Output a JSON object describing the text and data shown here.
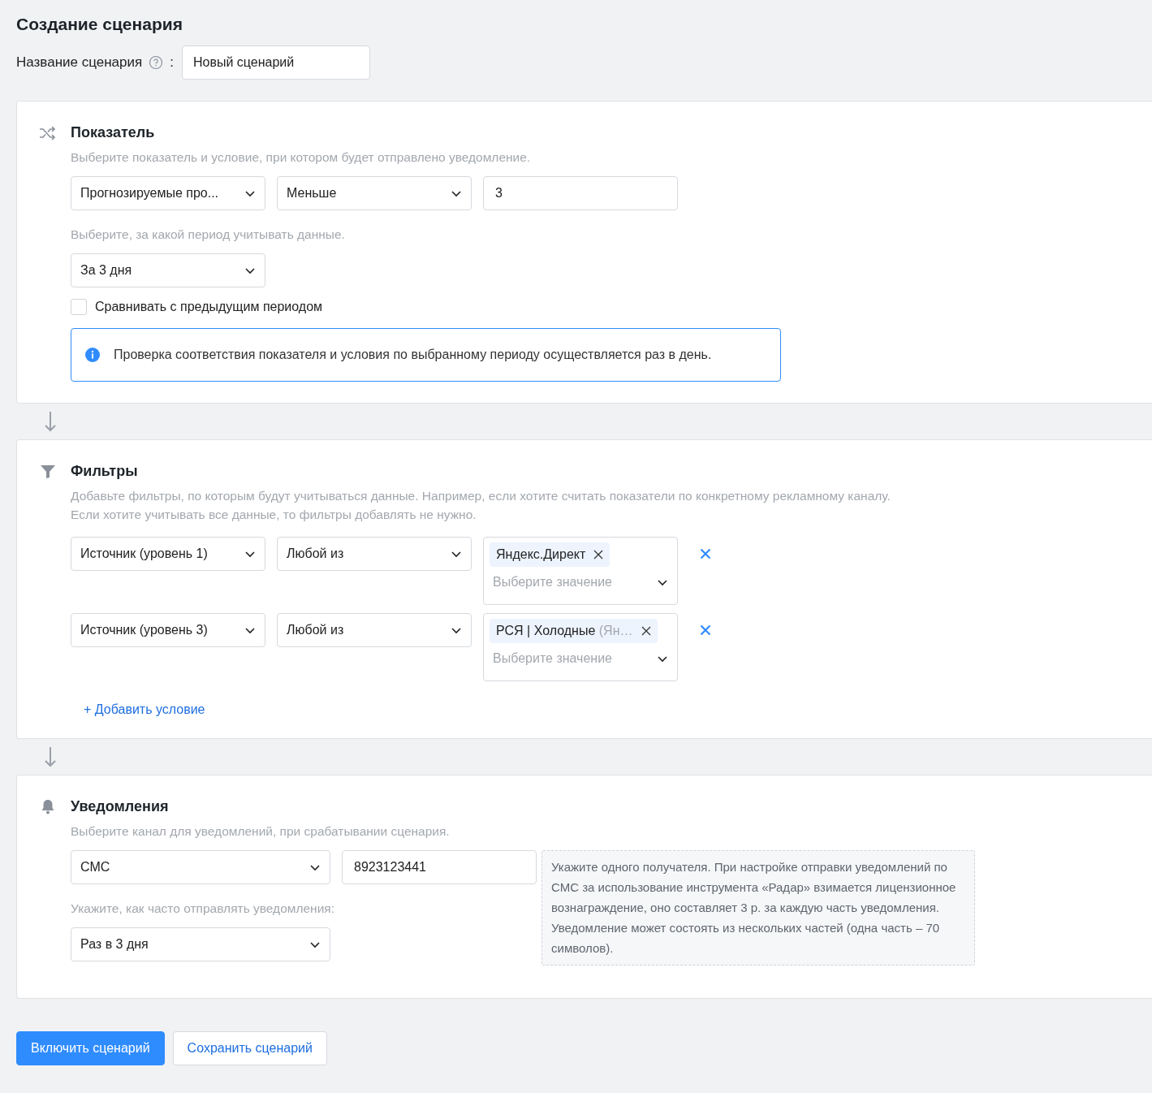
{
  "page_title": "Создание сценария",
  "scenario_name": {
    "label": "Название сценария",
    "colon": ":",
    "value": "Новый сценарий"
  },
  "metric": {
    "title": "Показатель",
    "hint": "Выберите показатель и условие, при котором будет отправлено уведомление.",
    "metric_select": "Прогнозируемые про...",
    "condition_select": "Меньше",
    "threshold": "3",
    "period_hint": "Выберите, за какой период учитывать данные.",
    "period_select": "За 3 дня",
    "compare": {
      "label": "Сравнивать с предыдущим периодом",
      "checked": false
    },
    "info": "Проверка соответствия показателя и условия по выбранному периоду осуществляется раз в день."
  },
  "filters": {
    "title": "Фильтры",
    "description": [
      "Добавьте фильтры, по которым будут учитываться данные. Например, если хотите считать показатели по конкретному рекламному каналу.",
      "Если хотите учитывать все данные, то фильтры добавлять не нужно."
    ],
    "rows": [
      {
        "field": "Источник (уровень 1)",
        "operator": "Любой из",
        "tags": [
          {
            "label": "Яндекс.Директ"
          }
        ],
        "placeholder": "Выберите значение"
      },
      {
        "field": "Источник (уровень 3)",
        "operator": "Любой из",
        "tags": [
          {
            "label": "РСЯ | Холодные",
            "muted_part": "(Ян…"
          }
        ],
        "placeholder": "Выберите значение"
      }
    ],
    "add_label": "+ Добавить условие"
  },
  "notifications": {
    "title": "Уведомления",
    "hint": "Выберите канал для уведомлений, при срабатывании сценария.",
    "channel": "СМС",
    "recipient": "8923123441",
    "frequency_hint": "Укажите, как часто отправлять уведомления:",
    "frequency": "Раз в 3 дня",
    "note": "Укажите одного получателя. При настройке отправки уведомлений по СМС за использование инструмента «Радар» взимается лицензионное вознаграждение, оно составляет 3 р. за каждую часть уведомления. Уведомление может состоять из нескольких частей (одна часть – 70 символов)."
  },
  "buttons": [
    {
      "label": "Включить сценарий",
      "kind": "primary"
    },
    {
      "label": "Сохранить сценарий",
      "kind": "secondary"
    }
  ]
}
